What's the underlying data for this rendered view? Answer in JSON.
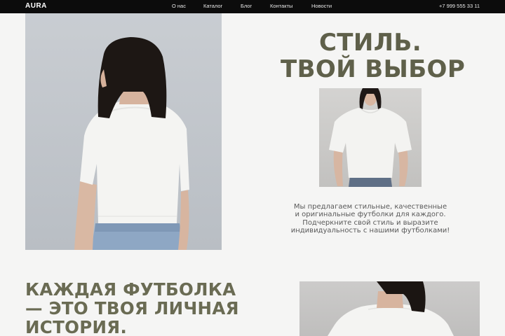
{
  "nav": {
    "logo": "AURA",
    "items": [
      {
        "label": "О нас"
      },
      {
        "label": "Каталог"
      },
      {
        "label": "Блог"
      },
      {
        "label": "Контакты"
      },
      {
        "label": "Новости"
      }
    ],
    "phone": "+7 999 555 33 11"
  },
  "hero": {
    "title_lines": [
      "СТИЛЬ.",
      "ТВОЙ ВЫБОР"
    ],
    "description_lines": [
      "Мы предлагаем стильные, качественные",
      "и оригинальные футболки для каждого.",
      "Подчеркните свой стиль и выразите",
      "индивидуальность с нашими футболками!"
    ]
  },
  "section2": {
    "title_lines": [
      "КАЖДАЯ ФУТБОЛКА",
      "— ЭТО ТВОЯ ЛИЧНАЯ",
      "ИСТОРИЯ."
    ]
  },
  "colors": {
    "nav_bg": "#0c0c0c",
    "accent_olive": "#5f604a",
    "page_bg": "#f5f5f4"
  }
}
